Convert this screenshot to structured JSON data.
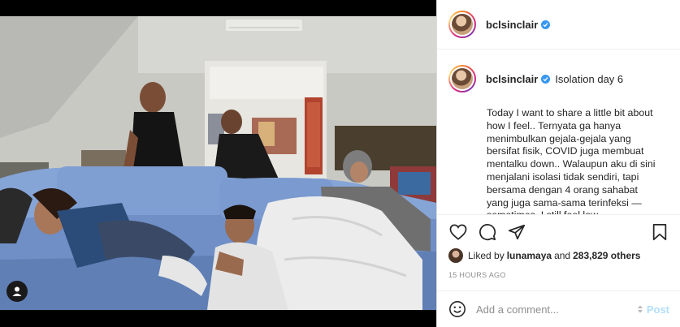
{
  "post": {
    "username": "bclsinclair",
    "verified": true,
    "caption_title": "Isolation day 6",
    "caption_body": "Today I want to share a little bit about\nhow I feel.. Ternyata ga hanya\nmenimbulkan gejala-gejala yang\nbersifat fisik, COVID juga membuat\nmentalku down.. Walaupun aku di sini\nmenjalani isolasi tidak sendiri, tapi\nbersama dengan 4 orang sahabat\nyang juga sama-sama terinfeksi —\nsometimes, I still feel low..",
    "liked_by_prefix": "Liked by",
    "liked_by_user": "lunamaya",
    "liked_by_joiner": "and",
    "liked_by_others": "283,829 others",
    "timestamp": "15 HOURS AGO"
  },
  "comment": {
    "placeholder": "Add a comment...",
    "post_label": "Post"
  },
  "icons": {
    "like": "heart-icon",
    "comment": "comment-icon",
    "share": "paper-plane-icon",
    "save": "bookmark-icon",
    "emoji": "emoji-icon",
    "tag": "user-tag-icon"
  },
  "colors": {
    "accent": "#3897f0",
    "post_disabled": "#b2dffc",
    "text": "#262626",
    "muted": "#8e8e8e"
  }
}
